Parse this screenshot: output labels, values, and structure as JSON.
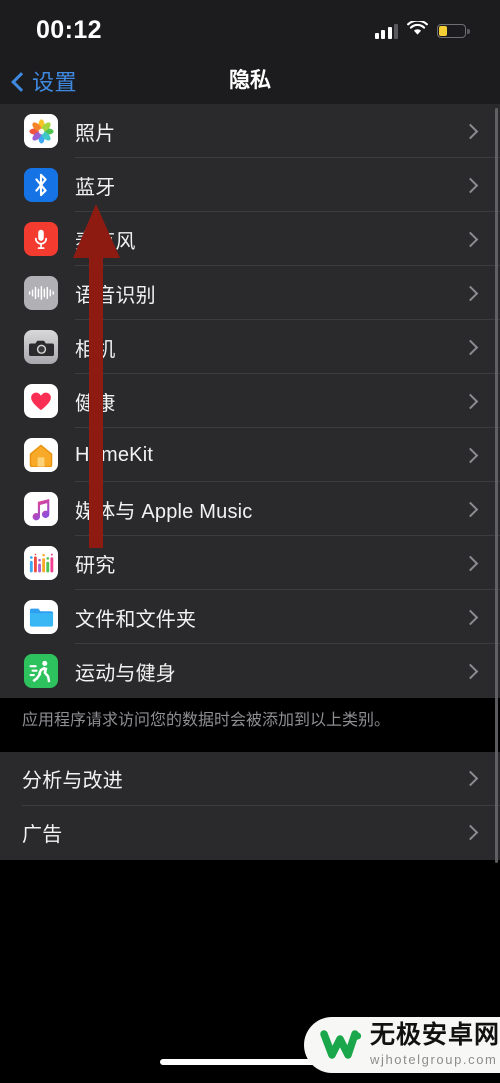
{
  "status_bar": {
    "time": "00:12",
    "signal_icon": "cellular-signal-icon",
    "wifi_icon": "wifi-icon",
    "battery_icon": "battery-low-power-icon",
    "battery_level_percent": 30,
    "battery_color": "#f5cf35"
  },
  "nav": {
    "back_label": "设置",
    "back_icon": "chevron-left-icon",
    "title": "隐私",
    "accent_color": "#3f8ae0"
  },
  "sections": [
    {
      "id": "privacy-categories",
      "rows": [
        {
          "label": "照片",
          "icon": "photos-icon",
          "icon_class": "ic-photos"
        },
        {
          "label": "蓝牙",
          "icon": "bluetooth-icon",
          "icon_class": "ic-bt"
        },
        {
          "label": "麦克风",
          "icon": "microphone-icon",
          "icon_class": "ic-mic"
        },
        {
          "label": "语音识别",
          "icon": "speech-recognition-icon",
          "icon_class": "ic-speech"
        },
        {
          "label": "相机",
          "icon": "camera-icon",
          "icon_class": "ic-cam"
        },
        {
          "label": "健康",
          "icon": "health-icon",
          "icon_class": "ic-health"
        },
        {
          "label": "HomeKit",
          "icon": "homekit-icon",
          "icon_class": "ic-home"
        },
        {
          "label": "媒体与 Apple Music",
          "icon": "music-icon",
          "icon_class": "ic-music"
        },
        {
          "label": "研究",
          "icon": "research-icon",
          "icon_class": "ic-research"
        },
        {
          "label": "文件和文件夹",
          "icon": "files-icon",
          "icon_class": "ic-files"
        },
        {
          "label": "运动与健身",
          "icon": "fitness-icon",
          "icon_class": "ic-fitness"
        }
      ],
      "footnote": "应用程序请求访问您的数据时会被添加到以上类别。"
    },
    {
      "id": "privacy-other",
      "rows": [
        {
          "label": "分析与改进",
          "icon": null,
          "icon_class": null
        },
        {
          "label": "广告",
          "icon": null,
          "icon_class": null
        }
      ],
      "footnote": null
    }
  ],
  "annotation": {
    "type": "arrow",
    "color": "#8e1b12",
    "direction": "up",
    "points_to": "蓝牙"
  },
  "watermark": {
    "brand": "无极安卓网",
    "url": "wjhotelgroup.com",
    "logo_color": "#1aa64b"
  },
  "home_indicator": "home-indicator"
}
